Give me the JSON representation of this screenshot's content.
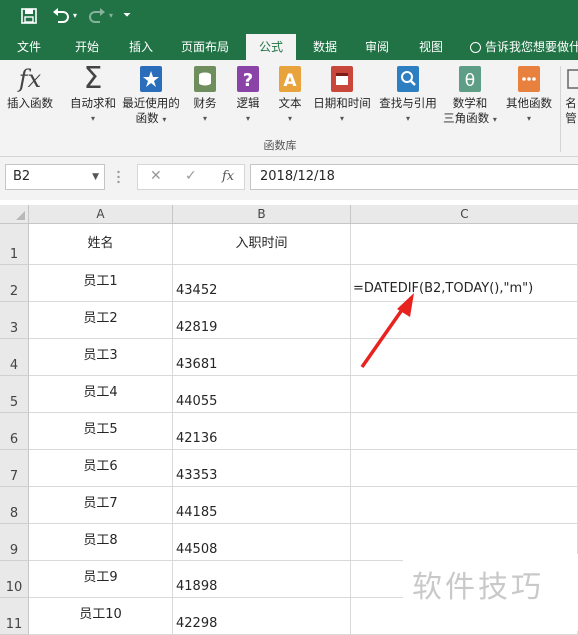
{
  "ribbon_tabs": [
    "文件",
    "开始",
    "插入",
    "页面布局",
    "公式",
    "数据",
    "审阅",
    "视图"
  ],
  "active_tab": "公式",
  "tell_me": "告诉我您想要做什",
  "ribbon": {
    "insert_function": "插入函数",
    "autosum": "自动求和",
    "recently_used": "最近使用的",
    "recently_used_2": "函数",
    "financial": "财务",
    "logical": "逻辑",
    "text": "文本",
    "date_time": "日期和时间",
    "lookup_ref": "查找与引用",
    "math_trig": "数学和",
    "math_trig_2": "三角函数",
    "more_functions": "其他函数",
    "partial_1": "名",
    "partial_2": "管",
    "group_label": "函数库"
  },
  "formula_bar": {
    "name_box": "B2",
    "value": "2018/12/18",
    "cancel": "✕",
    "enter": "✓",
    "fx": "fx"
  },
  "sheet": {
    "columns": [
      "A",
      "B",
      "C"
    ],
    "rows": [
      "1",
      "2",
      "3",
      "4",
      "5",
      "6",
      "7",
      "8",
      "9",
      "10",
      "11"
    ],
    "header_name": "姓名",
    "header_date": "入职时间",
    "names": [
      "员工1",
      "员工2",
      "员工3",
      "员工4",
      "员工5",
      "员工6",
      "员工7",
      "员工8",
      "员工9",
      "员工10"
    ],
    "dates": [
      "43452",
      "42819",
      "43681",
      "44055",
      "42136",
      "43353",
      "44185",
      "44508",
      "41898",
      "42298"
    ],
    "formula": "=DATEDIF(B2,TODAY(),\"m\")"
  },
  "watermark": "软件技巧",
  "colors": {
    "excel_green": "#217346",
    "arrow_red": "#e8231f"
  }
}
